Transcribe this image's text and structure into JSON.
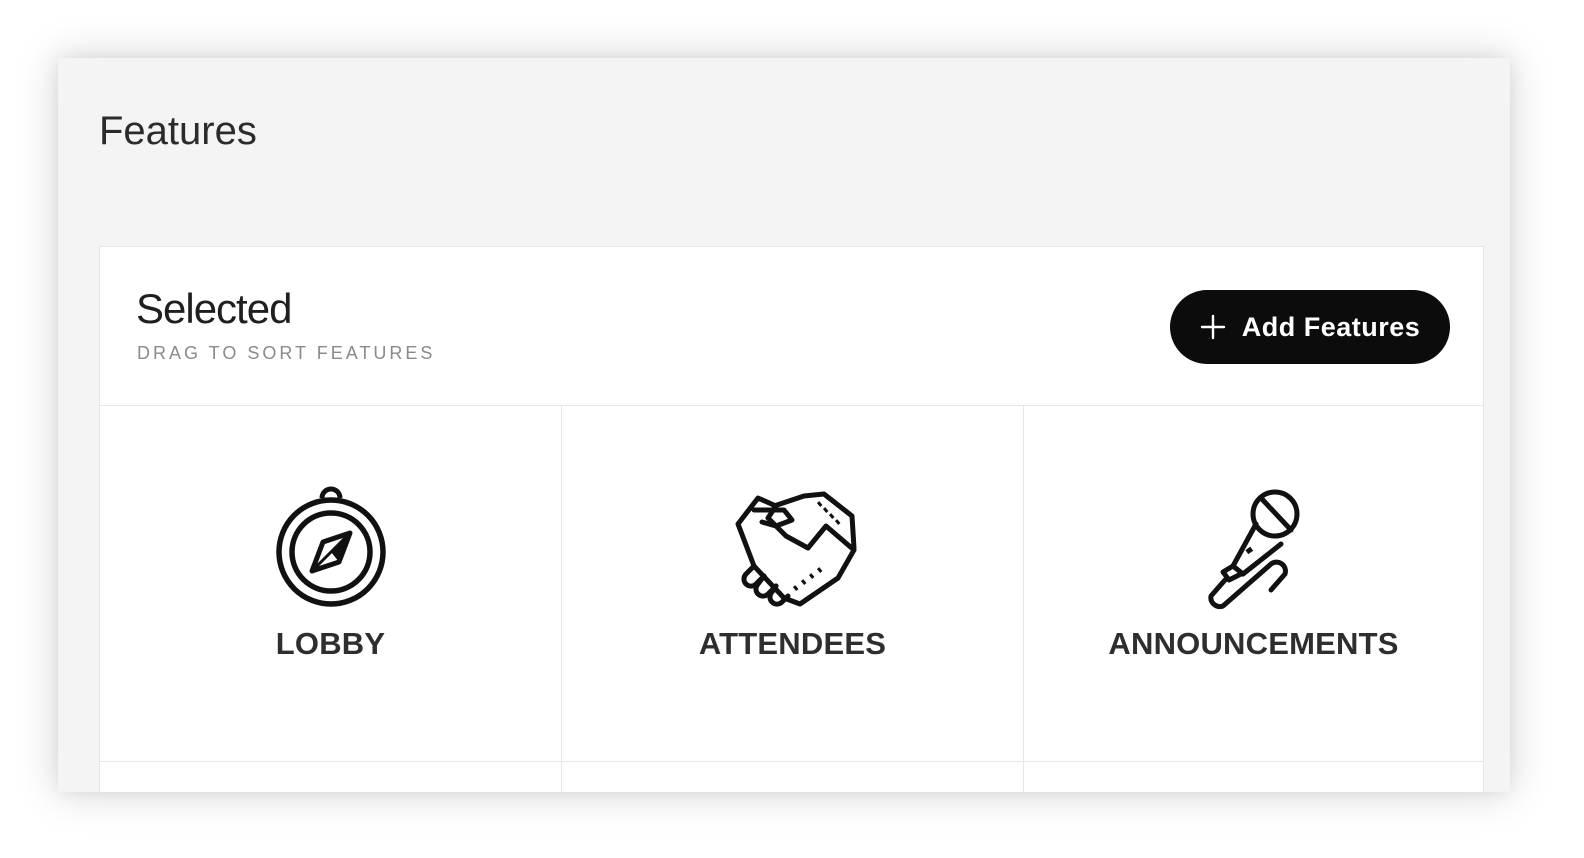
{
  "page": {
    "title": "Features"
  },
  "selected_panel": {
    "title": "Selected",
    "subtitle": "DRAG TO SORT FEATURES",
    "add_button_label": "Add Features"
  },
  "features": [
    {
      "label": "LOBBY",
      "icon": "compass-icon"
    },
    {
      "label": "ATTENDEES",
      "icon": "handshake-icon"
    },
    {
      "label": "ANNOUNCEMENTS",
      "icon": "microphone-icon"
    }
  ],
  "colors": {
    "window_bg": "#f4f4f4",
    "panel_bg": "#ffffff",
    "button_bg": "#0c0c0c",
    "button_text": "#ffffff",
    "label_text": "#2e2e2e",
    "subtitle_text": "#8a8a8a"
  }
}
